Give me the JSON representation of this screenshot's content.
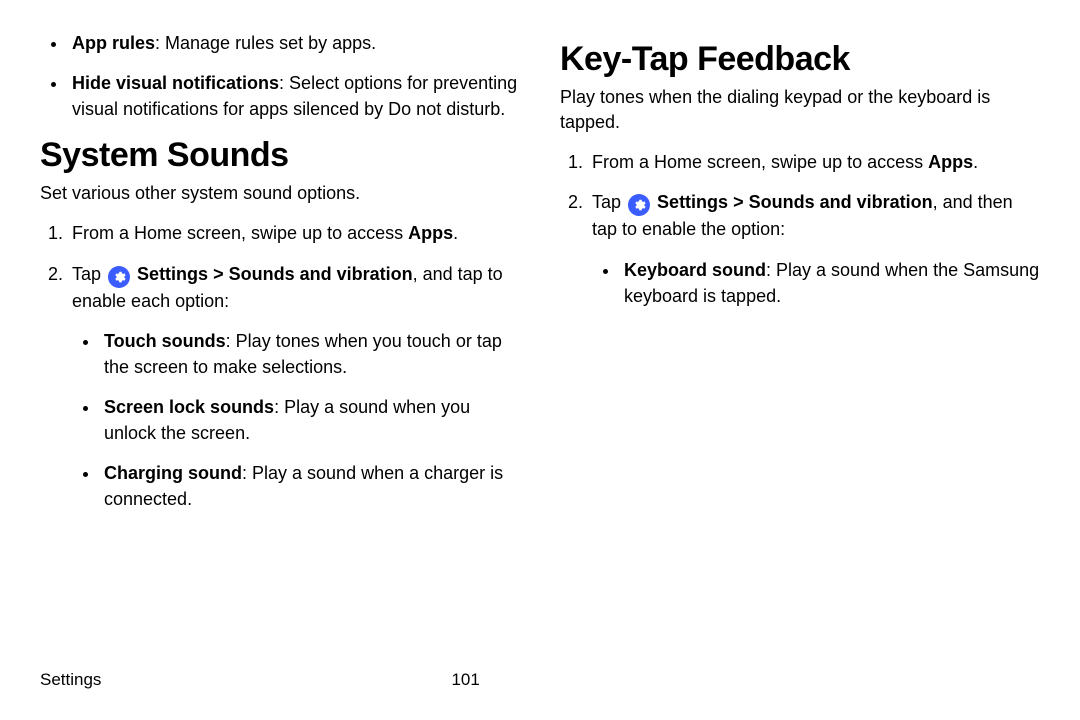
{
  "left": {
    "top_bullets": [
      {
        "label": "App rules",
        "text": ": Manage rules set by apps."
      },
      {
        "label": "Hide visual notifications",
        "text": ": Select options for preventing visual notifications for apps silenced by Do not disturb."
      }
    ],
    "heading": "System Sounds",
    "intro": "Set various other system sound options.",
    "step1_a": "From a Home screen, swipe up to access ",
    "step1_b": "Apps",
    "step1_c": ".",
    "step2_a": "Tap ",
    "step2_b": "Settings",
    "step2_c": " > ",
    "step2_d": "Sounds and vibration",
    "step2_e": ", and tap to enable each option:",
    "sub_bullets": [
      {
        "label": "Touch sounds",
        "text": ": Play tones when you touch or tap the screen to make selections."
      },
      {
        "label": "Screen lock sounds",
        "text": ": Play a sound when you unlock the screen."
      },
      {
        "label": "Charging sound",
        "text": ": Play a sound when a charger is connected."
      }
    ]
  },
  "right": {
    "heading": "Key-Tap Feedback",
    "intro": "Play tones when the dialing keypad or the keyboard is tapped.",
    "step1_a": "From a Home screen, swipe up to access ",
    "step1_b": "Apps",
    "step1_c": ".",
    "step2_a": "Tap ",
    "step2_b": "Settings",
    "step2_c": " > ",
    "step2_d": "Sounds and vibration",
    "step2_e": ", and then tap to enable the option:",
    "sub_bullets": [
      {
        "label": "Keyboard sound",
        "text": ": Play a sound when the Samsung keyboard is tapped."
      }
    ]
  },
  "footer": {
    "section": "Settings",
    "page": "101"
  }
}
